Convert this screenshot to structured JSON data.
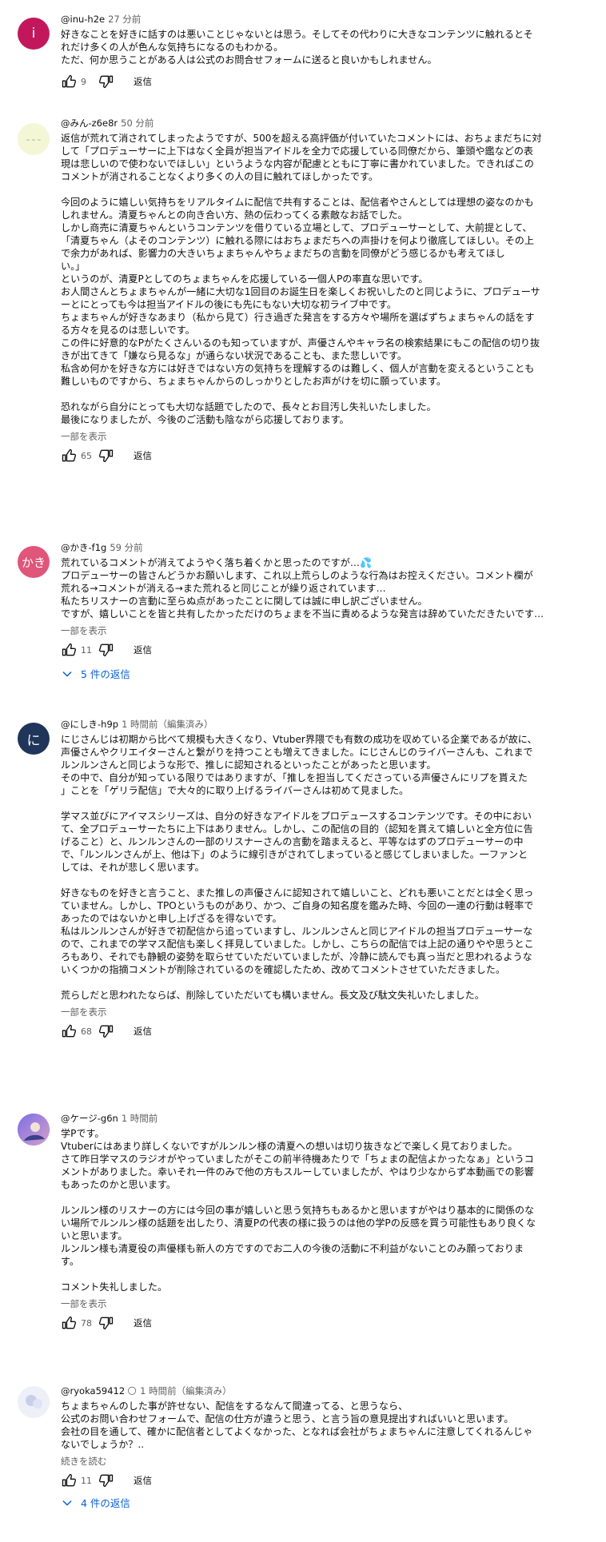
{
  "comments": [
    {
      "author": "@inu-h2e",
      "time": "27 分前",
      "avatar_letter": "i",
      "avatar_color": "#c2185b",
      "lines": [
        "好きなことを好きに話すのは悪いことじゃないとは思う。そしてその代わりに大きなコンテンツに触れるとそ",
        "れだけ多くの人が色んな気持ちになるのもわかる。",
        "ただ、何か思うことがある人は公式のお問合せフォームに送ると良いかもしれません。"
      ],
      "likes": "9",
      "reply_label": "返信"
    },
    {
      "author": "@みん-z6e8r",
      "time": "50 分前",
      "avatar_letter": "",
      "avatar_color": "#f3f7d6",
      "lines": [
        "返信が荒れて消されてしまったようですが、500を超える高評価が付いていたコメントには、おちょまだちに対",
        "して「プロデューサーに上下はなく全員が担当アイドルを全力で応援している同僚だから、筆頭や鑑などの表",
        "現は悲しいので使わないでほしい」というような内容が配慮とともに丁寧に書かれていました。できればこの",
        "コメントが消されることなくより多くの人の目に触れてほしかったです。",
        "",
        "今回のように嬉しい気持ちをリアルタイムに配信で共有することは、配信者やさんとしては理想の姿なのかも",
        "しれません。清夏ちゃんとの向き合い方、熱の伝わってくる素敵なお話でした。",
        "しかし商売に清夏ちゃんというコンテンツを借りている立場として、プロデューサーとして、大前提として、",
        "「清夏ちゃん（よそのコンテンツ）に触れる際にはおちょまだちへの声掛けを何より徹底してほしい。その上",
        "で余力があれば、影響力の大きいちょまちゃんやちょまだちの言動を同僚がどう感じるかも考えてほし",
        "い。」",
        "というのが、清夏Pとしてのちょまちゃんを応援している一個人Pの率直な思いです。",
        "お人間さんとちょまちゃんが一緒に大切な1回目のお誕生日を楽しくお祝いしたのと同じように、プロデューサ",
        "ーとにとっても今は担当アイドルの後にも先にもない大切な初ライブ中です。",
        "ちょまちゃんが好きなあまり（私から見て）行き過ぎた発言をする方々や場所を選ばずちょまちゃんの話をす",
        "る方々を見るのは悲しいです。",
        "この件に好意的なPがたくさんいるのも知っていますが、声優さんやキャラ名の検索結果にもこの配信の切り抜",
        "きが出てきて「嫌なら見るな」が通らない状況であることも、また悲しいです。",
        "私含め何かを好きな方には好きではない方の気持ちを理解するのは難しく、個人が言動を変えるということも",
        "難しいものですから、ちょまちゃんからのしっかりとしたお声がけを切に願っています。",
        "",
        "恐れながら自分にとっても大切な話題でしたので、長々とお目汚し失礼いたしました。",
        "最後になりましたが、今後のご活動も陰ながら応援しております。"
      ],
      "more_label": "一部を表示",
      "likes": "65",
      "reply_label": "返信"
    },
    {
      "author": "@かき-f1g",
      "time": "59 分前",
      "avatar_letter": "かき",
      "avatar_color": "#e0557a",
      "lines": [
        "荒れているコメントが消えてようやく落ち着くかと思ったのですが…💦",
        "プロデューサーの皆さんどうかお願いします、これ以上荒らしのような行為はお控えください。コメント欄が",
        "荒れる→コメントが消える→また荒れると同じことが繰り返されています…",
        "私たちリスナーの言動に至らぬ点があったことに関しては誠に申し訳ございません。",
        "ですが、嬉しいことを皆と共有したかっただけのちょまを不当に責めるような発言は辞めていただきたいです…"
      ],
      "more_label": "一部を表示",
      "likes": "11",
      "reply_label": "返信",
      "replies_label": "5 件の返信"
    },
    {
      "author": "@にしき-h9p",
      "time": "1 時間前（編集済み）",
      "avatar_letter": "に",
      "avatar_color": "#1f3559",
      "lines": [
        "にじさんじは初期から比べて規模も大きくなり、Vtuber界隈でも有数の成功を収めている企業であるが故に、",
        "声優さんやクリエイターさんと繋がりを持つことも増えてきました。にじさんじのライバーさんも、これまで",
        "ルンルンさんと同じような形で、推しに認知されるといったことがあったと思います。",
        "その中で、自分が知っている限りではありますが、「推しを担当してくださっている声優さんにリプを貰えた",
        "」ことを「ゲリラ配信」で大々的に取り上げるライバーさんは初めて見ました。",
        "",
        "学マス並びにアイマスシリーズは、自分の好きなアイドルをプロデュースするコンテンツです。その中におい",
        "て、全プロデューサーたちに上下はありません。しかし、この配信の目的（認知を貰えて嬉しいと全方位に告",
        "げること）と、ルンルンさんの一部のリスナーさんの言動を踏まえると、平等なはずのプロデューサーの中",
        "で、「ルンルンさんが上、他は下」のように線引きがされてしまっていると感じてしまいました。一ファンと",
        "しては、それが悲しく思います。",
        "",
        "好きなものを好きと言うこと、また推しの声優さんに認知されて嬉しいこと、どれも悪いことだとは全く思っ",
        "ていません。しかし、TPOというものがあり、かつ、ご自身の知名度を鑑みた時、今回の一連の行動は軽率で",
        "あったのではないかと申し上げざるを得ないです。",
        "私はルンルンさんが好きで初配信から追っていますし、ルンルンさんと同じアイドルの担当プロデューサーな",
        "ので、これまでの学マス配信も楽しく拝見していました。しかし、こちらの配信では上記の通りやや思うとこ",
        "ろもあり、それでも静観の姿勢を取らせていただいていましたが、冷静に読んでも真っ当だと思われるような",
        "いくつかの指摘コメントが削除されているのを確認したため、改めてコメントさせていただきました。",
        "",
        "荒らしだと思われたならば、削除していただいても構いません。長文及び駄文失礼いたしました。"
      ],
      "more_label": "一部を表示",
      "likes": "68",
      "reply_label": "返信"
    },
    {
      "author": "@ケージ-g6n",
      "time": "1 時間前",
      "avatar_letter": "",
      "avatar_color": "#6a5acd",
      "lines": [
        "学Pです。",
        "Vtuberにはあまり詳しくないですがルンルン様の清夏への想いは切り抜きなどで楽しく見ておりました。",
        "さて昨日学マスのラジオがやっていましたがそこの前半待機あたりで「ちょまの配信よかったなぁ」というコ",
        "メントがありました。幸いそれ一件のみで他の方もスルーしていましたが、やはり少なからず本動画での影響",
        "もあったのかと思います。",
        "",
        "ルンルン様のリスナーの方には今回の事が嬉しいと思う気持ちもあるかと思いますがやはり基本的に関係のな",
        "い場所でルンルン様の話題を出したり、清夏Pの代表の様に扱うのは他の学Pの反感を買う可能性もあり良くな",
        "いと思います。",
        "ルンルン様も清夏役の声優様も新人の方ですのでお二人の今後の活動に不利益がないことのみ願っておりま",
        "す。",
        "",
        "コメント失礼しました。"
      ],
      "more_label": "一部を表示",
      "likes": "78",
      "reply_label": "返信"
    },
    {
      "author": "@ryoka59412",
      "badge": "🌕",
      "time": "1 時間前（編集済み）",
      "avatar_letter": "",
      "avatar_color": "#eef0f8",
      "lines": [
        "ちょまちゃんのした事が許せない、配信をするなんて間違ってる、と思うなら、",
        "公式のお問い合わせフォームで、配信の仕方が違うと思う、と言う旨の意見提出すればいいと思います。",
        "会社の目を通して、確かに配信者としてよくなかった、となれば会社がちょまちゃんに注意してくれるんじゃ",
        "ないでしょうか？.."
      ],
      "more_label": "続きを読む",
      "likes": "11",
      "reply_label": "返信",
      "replies_label": "4 件の返信"
    }
  ]
}
